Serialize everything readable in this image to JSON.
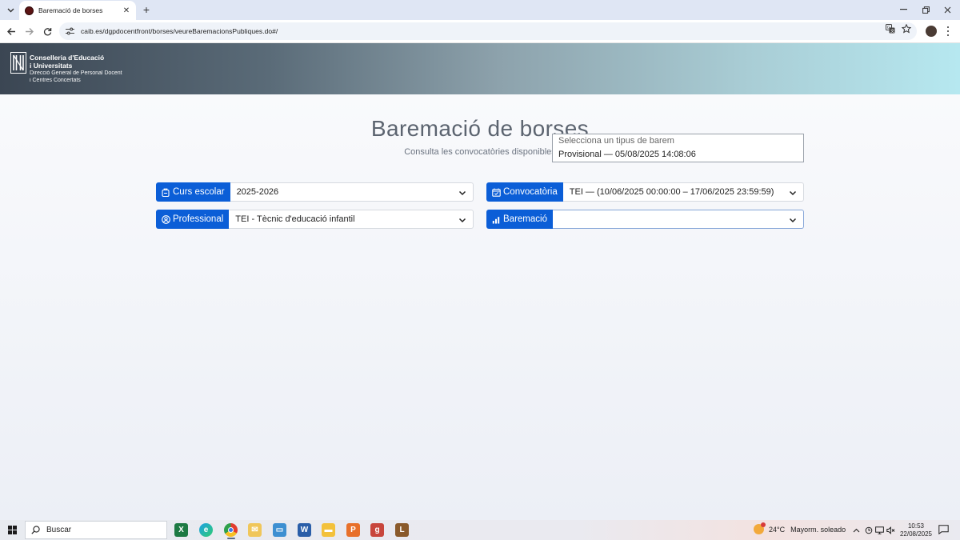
{
  "browser": {
    "tab_title": "Baremació de borses",
    "url": "caib.es/dgpdocentfront/borses/veureBaremacionsPubliques.do#/"
  },
  "banner": {
    "line1": "Conselleria d'Educació",
    "line2": "i Universitats",
    "line3": "Direcció General de Personal Docent",
    "line4": "i Centres Concertats"
  },
  "main": {
    "title": "Baremació de borses",
    "subtitle": "Consulta les convocatòries disponibles"
  },
  "filters": {
    "curs": {
      "label": "Curs escolar",
      "value": "2025-2026"
    },
    "convocatoria": {
      "label": "Convocatòria",
      "value": "TEI — (10/06/2025 00:00:00 – 17/06/2025 23:59:59)"
    },
    "professional": {
      "label": "Professional",
      "value": "TEI - Tècnic d'educació infantil"
    },
    "baremacio": {
      "label": "Baremació",
      "value": "",
      "options": [
        "Selecciona un tipus de barem",
        "Provisional — 05/08/2025 14:08:06"
      ]
    }
  },
  "taskbar": {
    "search_placeholder": "Buscar",
    "weather_temp": "24°C",
    "weather_desc": "Mayorm. soleado",
    "time": "10:53",
    "date": "22/08/2025"
  },
  "colors": {
    "accent": "#0b5ed7"
  }
}
